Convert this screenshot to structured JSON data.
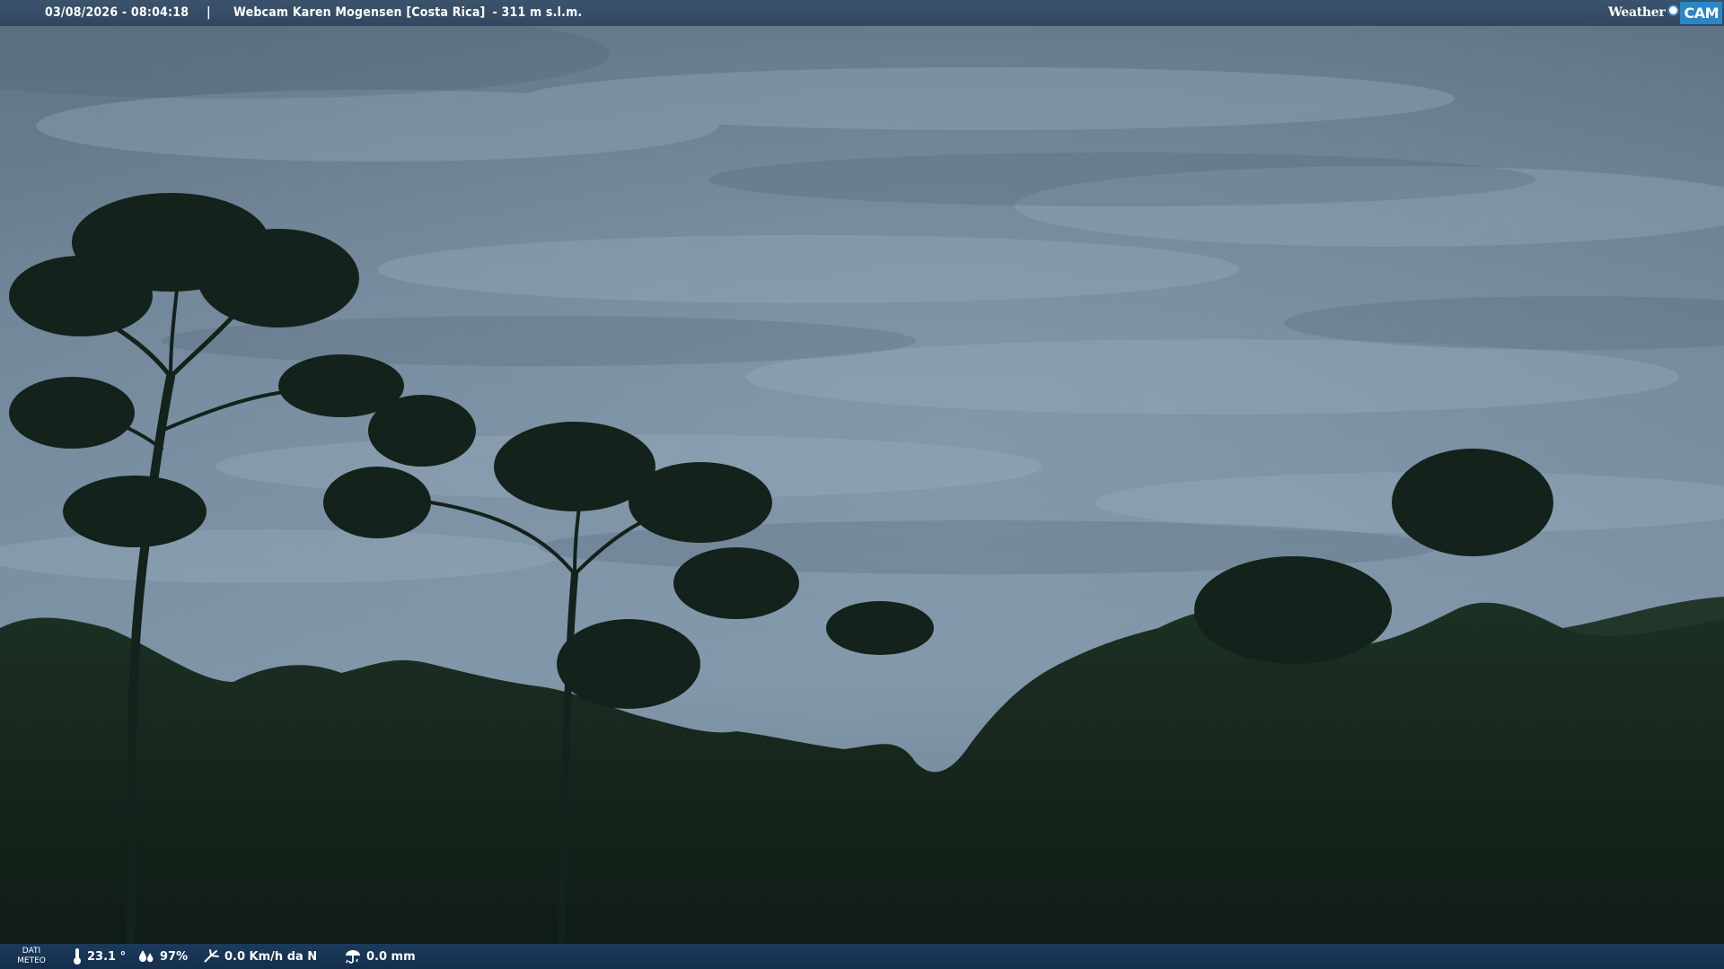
{
  "header": {
    "datetime": "03/08/2026 - 08:04:18",
    "separator": "|",
    "title": "Webcam Karen Mogensen [Costa Rica]",
    "altitude": "- 311 m s.l.m."
  },
  "logo": {
    "word1": "Weather",
    "word2": "CAM",
    "accent_color": "#2a86c9"
  },
  "meteo": {
    "label_line1": "DATI",
    "label_line2": "METEO",
    "temperature": "23.1 °",
    "humidity": "97%",
    "wind": "0.0 Km/h da N",
    "rain": "0.0 mm",
    "icons": [
      "thermometer-icon",
      "humidity-icon",
      "wind-icon",
      "rain-icon"
    ]
  },
  "scene": {
    "sky_color": "#6f8394",
    "foliage_color": "#16261c"
  }
}
